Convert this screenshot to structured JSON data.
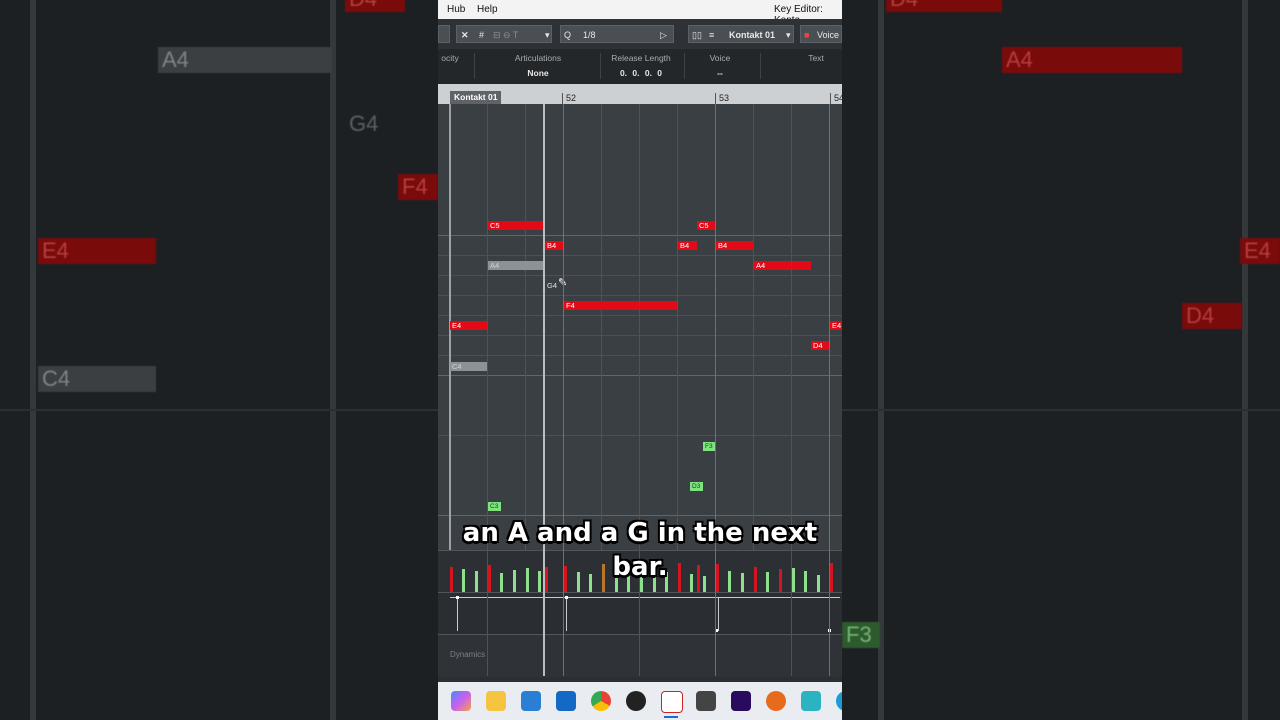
{
  "menu": {
    "hub": "Hub",
    "help": "Help",
    "window_title": "Key Editor: Konta"
  },
  "toolbar": {
    "quantize_value": "1/8",
    "instrument": "Kontakt 01",
    "voice_button": "Voice"
  },
  "info": {
    "velocity_label": "ocity",
    "articulations_label": "Articulations",
    "articulations_value": "None",
    "release_label": "Release Length",
    "release_value": "0. 0. 0.   0",
    "voice_label": "Voice",
    "voice_value": "--",
    "text_label": "Text"
  },
  "ruler": {
    "track_name": "Kontakt 01",
    "bar52": "52",
    "bar53": "53",
    "bar54": "54"
  },
  "notes": {
    "c5a": "C5",
    "b4a": "B4",
    "a4gray": "A4",
    "g4": "G4",
    "f4": "F4",
    "e4a": "E4",
    "c4gray": "C4",
    "c5b": "C5",
    "b4b": "B4",
    "b4c": "B4",
    "a4": "A4",
    "e4b": "E4",
    "d4": "D4",
    "f3": "F3",
    "d3": "D3",
    "c3": "C3"
  },
  "lanes": {
    "dynamics": "Dynamics"
  },
  "background": {
    "d4_top": "D4",
    "a4_left": "A4",
    "g4_left": "G4",
    "f4_left": "F4",
    "e4_left": "E4",
    "c4_left": "C4",
    "d4_right_top": "D4",
    "a4_right": "A4",
    "e4_right": "E4",
    "d4_right": "D4",
    "f3_right": "F3"
  },
  "caption": {
    "line1": "an A and a G in the next",
    "line2": "bar."
  },
  "taskbar": {
    "icons": [
      "copilot-icon",
      "file-explorer-icon",
      "store-icon",
      "outlook-icon",
      "chrome-icon",
      "obs-icon",
      "cubase-icon",
      "voice-app-icon",
      "premiere-icon",
      "audition-icon",
      "editor-icon",
      "edge-icon"
    ]
  },
  "colors": {
    "note_red": "#e30a17",
    "note_green": "#7ee27e",
    "note_gray": "#8d9296",
    "grid_bg": "#3a3f44"
  }
}
